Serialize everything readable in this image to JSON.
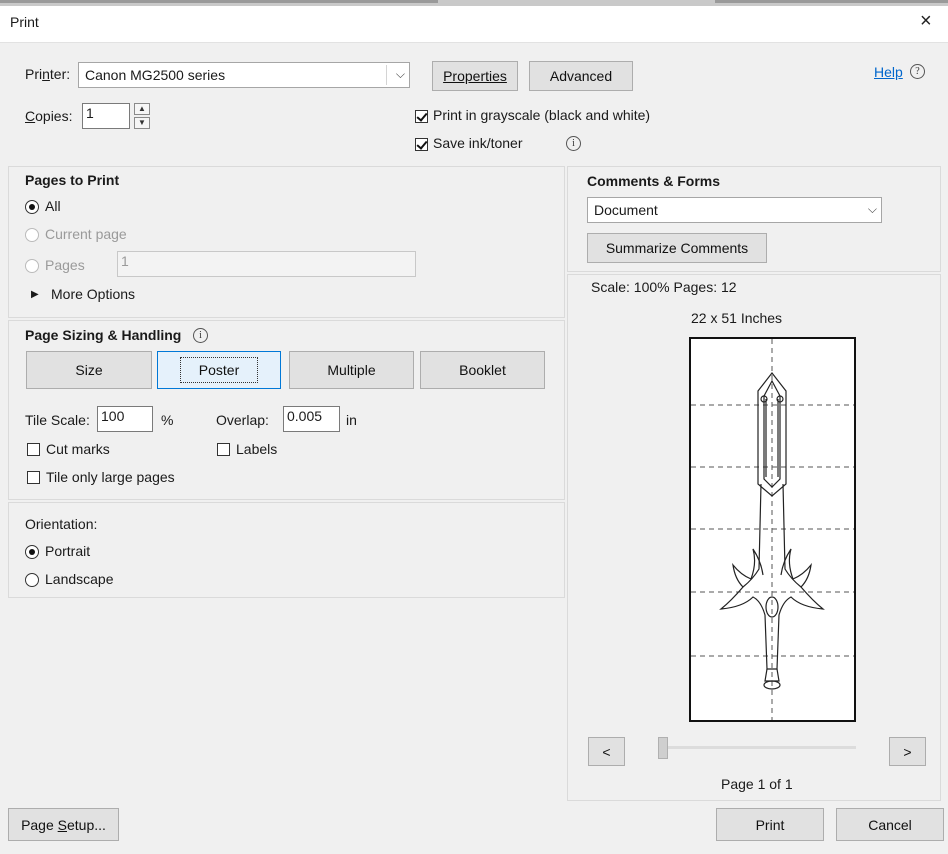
{
  "window": {
    "title": "Print",
    "close_glyph": "×"
  },
  "printer": {
    "label": "Printer:",
    "value": "Canon MG2500 series",
    "properties_label": "Properties",
    "advanced_label": "Advanced",
    "help_label": "Help",
    "help_icon": "?"
  },
  "copies": {
    "label": "Copies:",
    "value": "1"
  },
  "options": {
    "grayscale_label": "Print in grayscale (black and white)",
    "grayscale_checked": true,
    "save_ink_label": "Save ink/toner",
    "save_ink_checked": true,
    "info_glyph": "i"
  },
  "pages_to_print": {
    "heading": "Pages to Print",
    "all_label": "All",
    "current_label": "Current page",
    "pages_label": "Pages",
    "pages_value": "1",
    "more_options_label": "More Options",
    "more_options_glyph": "▶"
  },
  "sizing": {
    "heading": "Page Sizing & Handling",
    "tabs": [
      "Size",
      "Poster",
      "Multiple",
      "Booklet"
    ],
    "active_tab": "Poster",
    "tile_scale_label": "Tile Scale:",
    "tile_scale_value": "100",
    "percent": "%",
    "overlap_label": "Overlap:",
    "overlap_value": "0.005",
    "overlap_unit": "in",
    "cut_marks_label": "Cut marks",
    "labels_label": "Labels",
    "tile_large_label": "Tile only large pages"
  },
  "orientation": {
    "heading": "Orientation:",
    "portrait_label": "Portrait",
    "landscape_label": "Landscape",
    "selected": "Portrait"
  },
  "comments": {
    "heading": "Comments & Forms",
    "value": "Document",
    "summarize_label": "Summarize Comments"
  },
  "preview": {
    "scale_text": "Scale: 100% Pages: 12",
    "size_text": "22 x 51 Inches",
    "prev_glyph": "<",
    "next_glyph": ">",
    "page_text": "Page 1 of 1",
    "slider_position": 0
  },
  "footer": {
    "page_setup_label": "Page Setup...",
    "print_label": "Print",
    "cancel_label": "Cancel"
  },
  "colors": {
    "accent": "#0078d7",
    "help_link": "#0066cc",
    "background": "#f0f0f0"
  }
}
